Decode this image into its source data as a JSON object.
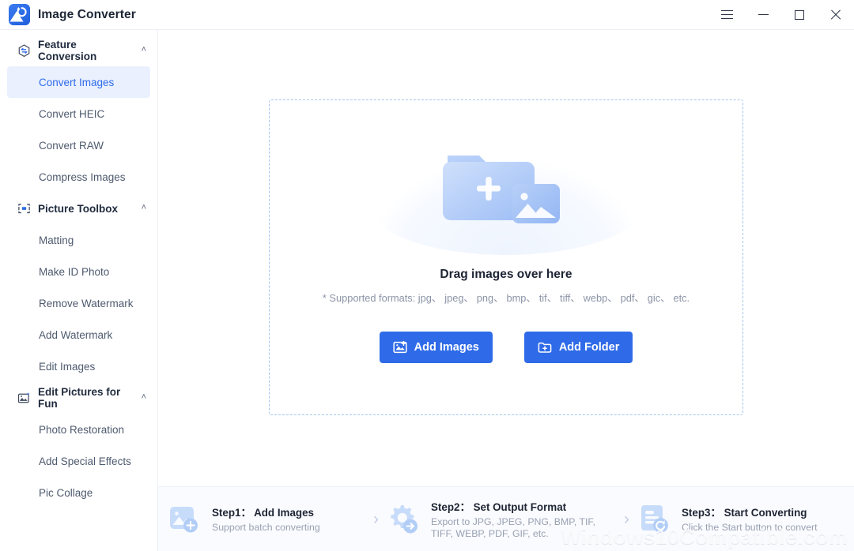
{
  "window": {
    "app_title": "Image Converter",
    "logo_icon": "image-converter-logo-icon",
    "controls": {
      "menu": "hamburger-menu-icon",
      "minimize": "minimize-icon",
      "maximize": "maximize-icon",
      "close": "close-icon"
    }
  },
  "sidebar": {
    "groups": [
      {
        "title": "Feature Conversion",
        "icon": "convert-hexagon-icon",
        "expanded": true,
        "chevron": "˄",
        "items": [
          {
            "label": "Convert Images",
            "active": true
          },
          {
            "label": "Convert HEIC",
            "active": false
          },
          {
            "label": "Convert RAW",
            "active": false
          },
          {
            "label": "Compress Images",
            "active": false
          }
        ]
      },
      {
        "title": "Picture Toolbox",
        "icon": "toolbox-frame-icon",
        "expanded": true,
        "chevron": "˄",
        "items": [
          {
            "label": "Matting",
            "active": false
          },
          {
            "label": "Make ID Photo",
            "active": false
          },
          {
            "label": "Remove Watermark",
            "active": false
          },
          {
            "label": "Add Watermark",
            "active": false
          },
          {
            "label": "Edit Images",
            "active": false
          }
        ]
      },
      {
        "title": "Edit Pictures for Fun",
        "icon": "sparkle-photo-icon",
        "expanded": true,
        "chevron": "˄",
        "items": [
          {
            "label": "Photo Restoration",
            "active": false
          },
          {
            "label": "Add Special Effects",
            "active": false
          },
          {
            "label": "Pic Collage",
            "active": false
          }
        ]
      }
    ]
  },
  "dropzone": {
    "illustration": "folder-add-image-illustration",
    "title": "Drag images over here",
    "formats": "* Supported formats: jpg、 jpeg、 png、 bmp、 tif、 tiff、 webp、 pdf、 gic、 etc.",
    "buttons": [
      {
        "label": "Add Images",
        "icon": "add-image-icon"
      },
      {
        "label": "Add Folder",
        "icon": "add-folder-icon"
      }
    ]
  },
  "steps": {
    "separator": "›",
    "items": [
      {
        "name": "Step1： Add Images",
        "desc": "Support batch converting",
        "icon": "step-add-image-icon"
      },
      {
        "name": "Step2： Set Output Format",
        "desc": "Export to JPG, JPEG, PNG, BMP, TIF, TIFF, WEBP, PDF, GIF, etc.",
        "icon": "step-gear-export-icon"
      },
      {
        "name": "Step3： Start Converting",
        "desc": "Click the Start button to convert",
        "icon": "step-document-convert-icon"
      }
    ]
  },
  "watermark": {
    "text": "Windows10Compatible.com"
  },
  "colors": {
    "accent": "#2f6be8",
    "active_item_bg": "#eaf0fe",
    "active_item_text": "#2f6bea",
    "dashed_border": "#a9c4ef",
    "footer_bg": "#fafbfe",
    "illustration_blue": "#a9c5f5"
  }
}
